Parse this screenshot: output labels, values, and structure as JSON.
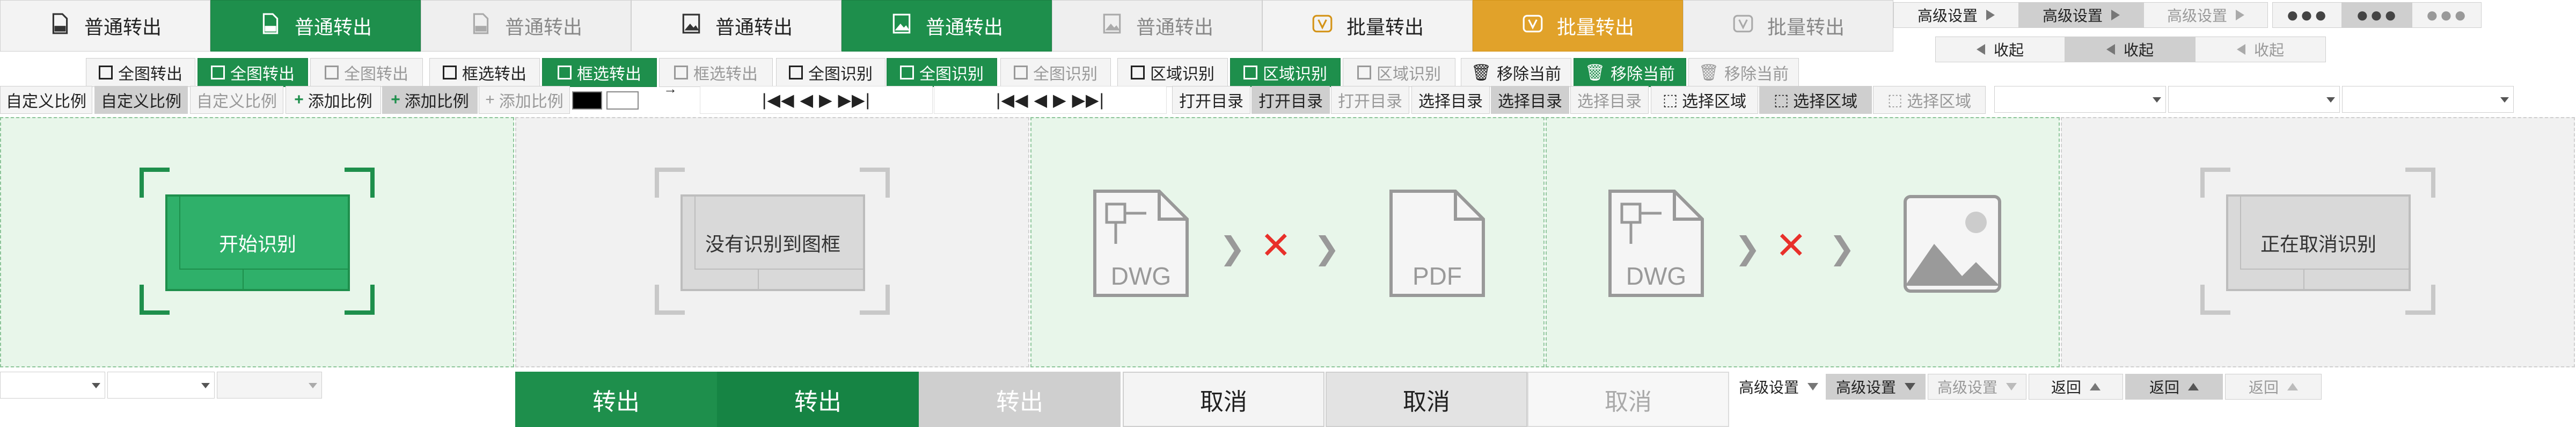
{
  "top_buttons": [
    {
      "label": "普通转出",
      "icon": "pdf-file-icon"
    },
    {
      "label": "普通转出",
      "icon": "pdf-file-icon"
    },
    {
      "label": "普通转出",
      "icon": "pdf-file-icon"
    },
    {
      "label": "普通转出",
      "icon": "image-file-icon"
    },
    {
      "label": "普通转出",
      "icon": "image-file-icon"
    },
    {
      "label": "普通转出",
      "icon": "image-file-icon"
    },
    {
      "label": "批量转出",
      "icon": "batch-v-icon"
    },
    {
      "label": "批量转出",
      "icon": "batch-v-icon"
    },
    {
      "label": "批量转出",
      "icon": "batch-v-icon"
    }
  ],
  "advanced": {
    "label": "高级设置",
    "collapse": "收起",
    "more": "●●●"
  },
  "row2": [
    "全图转出",
    "全图转出",
    "全图转出",
    "框选转出",
    "框选转出",
    "框选转出",
    "全图识别",
    "全图识别",
    "全图识别",
    "区域识别",
    "区域识别",
    "区域识别",
    "移除当前",
    "移除当前",
    "移除当前"
  ],
  "row3": {
    "custom_ratio": "自定义比例",
    "add_ratio": "添加比例",
    "pager": "|◀◀ ◀ ▶ ▶▶|",
    "open_dir": "打开目录",
    "select_dir": "选择目录",
    "select_area": "选择区域"
  },
  "panels": {
    "start": "开始识别",
    "none_found": "没有识别到图框",
    "dwg_label": "DWG",
    "pdf_label": "PDF",
    "cancelling": "正在取消识别"
  },
  "bottom": {
    "export": "转出",
    "cancel": "取消",
    "advanced": "高级设置",
    "back": "返回"
  },
  "colors": {
    "green": "#1e8f4c",
    "orange": "#e1a22a",
    "red": "#e8302a",
    "panel_green": "#e8f6ea",
    "gray": "#cfcfcf"
  }
}
